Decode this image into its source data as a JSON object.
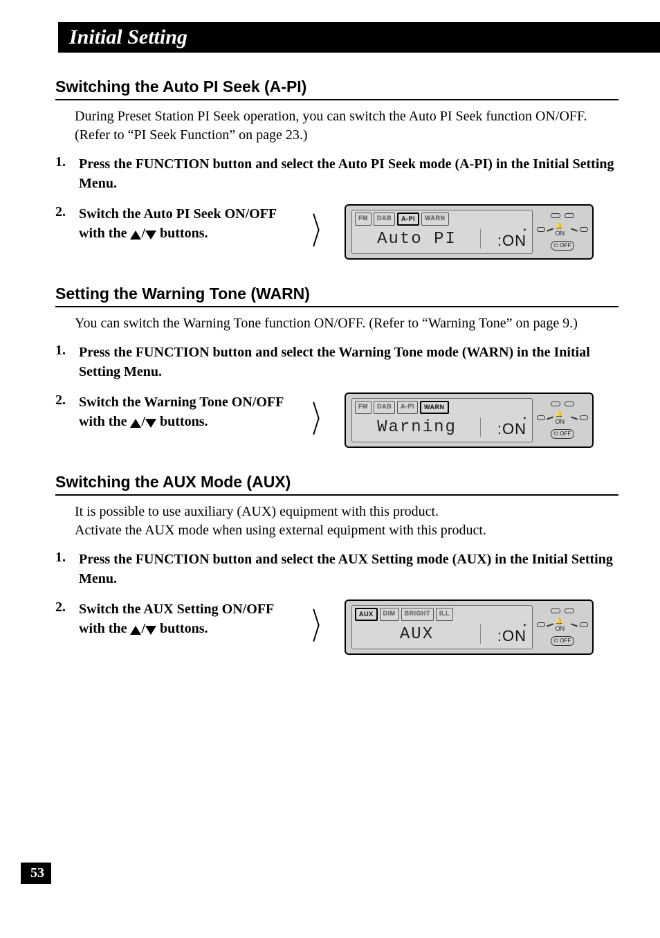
{
  "page": {
    "title": "Initial Setting",
    "number": "53"
  },
  "sections": [
    {
      "heading": "Switching the Auto PI Seek (A-PI)",
      "intro": "During Preset Station PI Seek operation, you can switch the Auto PI Seek function ON/OFF. (Refer to “PI Seek Function” on page 23.)",
      "steps": [
        {
          "num": "1.",
          "text": "Press the FUNCTION button and select the Auto PI Seek mode (A-PI) in the Initial Setting Menu."
        },
        {
          "num": "2.",
          "text_pre": "Switch the Auto PI Seek ON/OFF with the ",
          "text_post": " buttons.",
          "lcd": {
            "tabs": [
              "FM",
              "DAB",
              "A-PI",
              "WARN"
            ],
            "active_index": 2,
            "label": "Auto PI",
            "value": ":ON",
            "side_on": "ON",
            "side_off": "OFF"
          }
        }
      ]
    },
    {
      "heading": "Setting the Warning Tone (WARN)",
      "intro": "You can switch the Warning Tone function ON/OFF. (Refer to “Warning Tone” on page 9.)",
      "steps": [
        {
          "num": "1.",
          "text": "Press the FUNCTION button and select the Warning Tone mode (WARN) in the Initial Setting Menu."
        },
        {
          "num": "2.",
          "text_pre": "Switch the Warning Tone ON/OFF with the ",
          "text_post": " buttons.",
          "lcd": {
            "tabs": [
              "FM",
              "DAB",
              "A-PI",
              "WARN"
            ],
            "active_index": 3,
            "label": "Warning",
            "value": ":ON",
            "side_on": "ON",
            "side_off": "OFF"
          }
        }
      ]
    },
    {
      "heading": "Switching the AUX Mode (AUX)",
      "intro": "It is possible to use auxiliary (AUX) equipment with this product.\nActivate the AUX mode when using external equipment with this product.",
      "steps": [
        {
          "num": "1.",
          "text": "Press the FUNCTION button and select the AUX Setting mode (AUX) in the Initial Setting Menu."
        },
        {
          "num": "2.",
          "text_pre": "Switch the AUX Setting ON/OFF with the ",
          "text_post": " buttons.",
          "lcd": {
            "tabs": [
              "AUX",
              "DIM",
              "BRIGHT",
              "ILL"
            ],
            "active_index": 0,
            "label": "AUX",
            "value": ":ON",
            "side_on": "ON",
            "side_off": "OFF"
          }
        }
      ]
    }
  ]
}
